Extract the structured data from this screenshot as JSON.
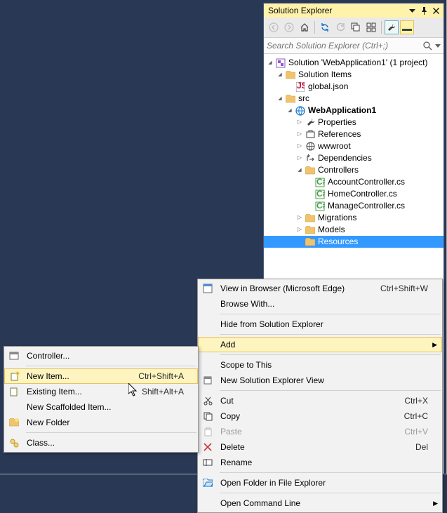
{
  "panel": {
    "title": "Solution Explorer",
    "search_placeholder": "Search Solution Explorer (Ctrl+;)"
  },
  "tree": {
    "solution": "Solution 'WebApplication1' (1 project)",
    "solution_items": "Solution Items",
    "global_json": "global.json",
    "src": "src",
    "project": "WebApplication1",
    "properties": "Properties",
    "references": "References",
    "wwwroot": "wwwroot",
    "dependencies": "Dependencies",
    "controllers": "Controllers",
    "account_ctrl": "AccountController.cs",
    "home_ctrl": "HomeController.cs",
    "manage_ctrl": "ManageController.cs",
    "migrations": "Migrations",
    "models": "Models",
    "resources": "Resources"
  },
  "contextMenu": {
    "view_in_browser": "View in Browser (Microsoft Edge)",
    "view_in_browser_acc": "Ctrl+Shift+W",
    "browse_with": "Browse With...",
    "hide": "Hide from Solution Explorer",
    "add": "Add",
    "scope": "Scope to This",
    "new_view": "New Solution Explorer View",
    "cut": "Cut",
    "cut_acc": "Ctrl+X",
    "copy": "Copy",
    "copy_acc": "Ctrl+C",
    "paste": "Paste",
    "paste_acc": "Ctrl+V",
    "delete": "Delete",
    "delete_acc": "Del",
    "rename": "Rename",
    "open_folder": "Open Folder in File Explorer",
    "open_cmd": "Open Command Line"
  },
  "addMenu": {
    "controller": "Controller...",
    "new_item": "New Item...",
    "new_item_acc": "Ctrl+Shift+A",
    "existing_item": "Existing Item...",
    "existing_item_acc": "Shift+Alt+A",
    "scaffolded": "New Scaffolded Item...",
    "new_folder": "New Folder",
    "class": "Class..."
  }
}
